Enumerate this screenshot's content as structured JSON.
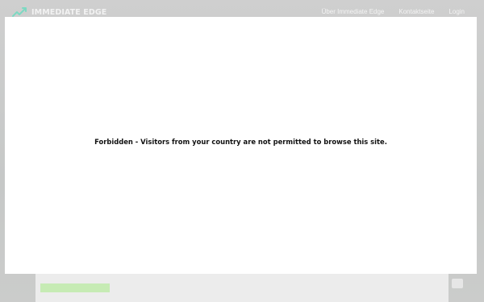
{
  "brand": {
    "name": "IMMEDIATE EDGE",
    "logo_icon": "chart-arrow-icon"
  },
  "nav": {
    "items": [
      {
        "label": "Über Immediate Edge"
      },
      {
        "label": "Kontaktseite"
      },
      {
        "label": "Login"
      }
    ]
  },
  "notice": {
    "message": "Forbidden - Visitors from your country are not permitted to browse this site."
  },
  "colors": {
    "accent": "#6fd3b8",
    "cta": "#c6ebb4",
    "overlay": "#ffffff"
  }
}
